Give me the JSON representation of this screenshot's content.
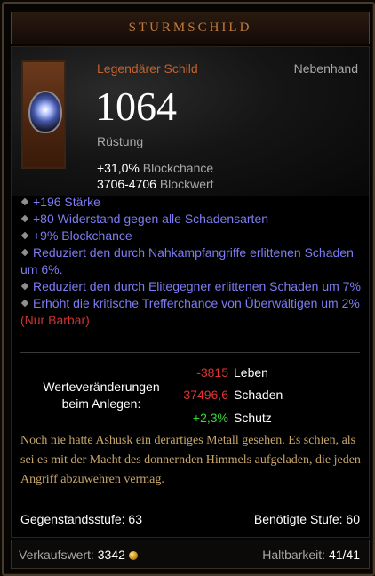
{
  "title": "STURMSCHILD",
  "item": {
    "type": "Legendärer Schild",
    "slot": "Nebenhand",
    "armor_value": "1064",
    "armor_label": "Rüstung",
    "block_chance_value": "+31,0%",
    "block_chance_label": "Blockchance",
    "block_value_value": "3706-4706",
    "block_value_label": "Blockwert",
    "icon": "shield-icon"
  },
  "affixes": [
    {
      "text": "+196 Stärke"
    },
    {
      "text": "+80 Widerstand gegen alle Schadensarten"
    },
    {
      "text": "+9% Blockchance"
    },
    {
      "text": "Reduziert den durch Nahkampfangriffe erlittenen Schaden um 6%."
    },
    {
      "text": "Reduziert den durch Elitegegner erlittenen Schaden um 7%"
    },
    {
      "text": "Erhöht die kritische Trefferchance von Überwältigen um 2%",
      "suffix": "(Nur Barbar)"
    }
  ],
  "changes": {
    "label_line1": "Werteveränderungen",
    "label_line2": "beim Anlegen:",
    "rows": [
      {
        "value": "-3815",
        "label": "Leben",
        "color": "#e33333"
      },
      {
        "value": "-37496,6",
        "label": "Schaden",
        "color": "#e33333"
      },
      {
        "value": "+2,3%",
        "label": "Schutz",
        "color": "#38d838"
      }
    ]
  },
  "flavor": "Noch nie hatte Ashusk ein derartiges Metall gesehen. Es schien, als sei es mit der Macht des donnernden Himmels aufgeladen, die jeden Angriff abzuwehren vermag.",
  "item_level_label": "Gegenstandsstufe:",
  "item_level_value": "63",
  "required_level_label": "Benötigte Stufe:",
  "required_level_value": "60",
  "sell_label": "Verkaufswert:",
  "sell_value": "3342",
  "durability_label": "Haltbarkeit:",
  "durability_value": "41/41",
  "colors": {
    "legendary": "#bf642f",
    "magic": "#7d7cf2",
    "flavor": "#c8a66a",
    "title": "#c07a3e"
  }
}
